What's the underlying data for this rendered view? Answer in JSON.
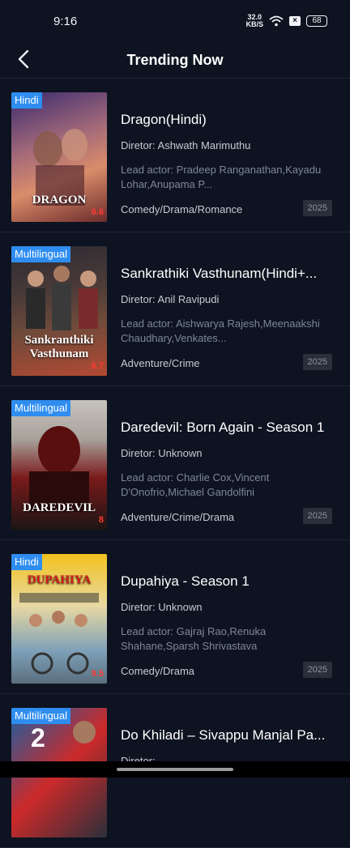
{
  "status": {
    "time": "9:16",
    "speed_value": "32.0",
    "speed_unit": "KB/S",
    "battery": "68"
  },
  "header": {
    "title": "Trending Now"
  },
  "labels": {
    "director": "Diretor:",
    "lead_actor": "Lead actor:"
  },
  "items": [
    {
      "badge": "Hindi",
      "title": "Dragon(Hindi)",
      "director": "Ashwath Marimuthu",
      "actors": "Pradeep Ranganathan,Kayadu Lohar,Anupama P...",
      "genre": "Comedy/Drama/Romance",
      "year": "2025",
      "rating": "6.6",
      "poster_text": "DRAGON",
      "poster_colors": [
        "#3a2a6e",
        "#d98c6a",
        "#6b2b2b"
      ]
    },
    {
      "badge": "Multilingual",
      "title": "Sankrathiki Vasthunam(Hindi+...",
      "director": "Anil Ravipudi",
      "actors": "Aishwarya Rajesh,Meenaakshi Chaudhary,Venkates...",
      "genre": "Adventure/Crime",
      "year": "2025",
      "rating": "6.7",
      "poster_text": "Sankranthiki Vasthunam",
      "poster_colors": [
        "#2b2b33",
        "#6d4a3a",
        "#b24a33"
      ]
    },
    {
      "badge": "Multilingual",
      "title": "Daredevil: Born Again - Season 1",
      "director": "Unknown",
      "actors": "Charlie Cox,Vincent D'Onofrio,Michael Gandolfini",
      "genre": "Adventure/Crime/Drama",
      "year": "2025",
      "rating": "8",
      "poster_text": "DAREDEVIL",
      "poster_colors": [
        "#c7c3bd",
        "#7a1a1a",
        "#1c1514"
      ]
    },
    {
      "badge": "Hindi",
      "title": "Dupahiya - Season 1",
      "director": "Unknown",
      "actors": "Gajraj Rao,Renuka Shahane,Sparsh Shrivastava",
      "genre": "Comedy/Drama",
      "year": "2025",
      "rating": "9.5",
      "poster_text": "DUPAHIYA",
      "poster_colors": [
        "#f2c21f",
        "#e8d9a2",
        "#7da0b8"
      ]
    },
    {
      "badge": "Multilingual",
      "title": "Do Khiladi – Sivappu Manjal Pa...",
      "director": "",
      "actors": "",
      "genre": "",
      "year": "",
      "rating": "",
      "poster_text": "",
      "poster_colors": [
        "#1b5fa3",
        "#cc2a2a",
        "#2b2f3a"
      ]
    }
  ]
}
